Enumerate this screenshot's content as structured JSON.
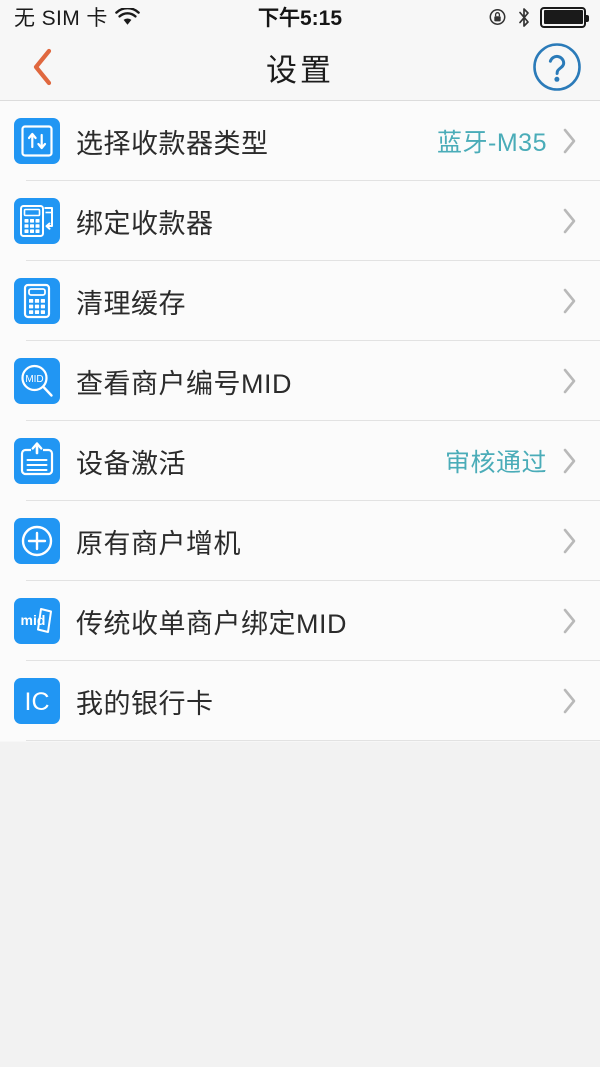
{
  "status_bar": {
    "carrier": "无 SIM 卡",
    "time": "下午5:15",
    "wifi_icon": "wifi-icon",
    "rotation_lock_icon": "rotation-lock-icon",
    "bluetooth_icon": "bluetooth-icon",
    "battery_icon": "battery-icon",
    "battery_level": 100
  },
  "nav": {
    "title": "设置",
    "back_icon": "chevron-left-icon",
    "help_icon": "question-circle-icon",
    "back_color": "#e0683f",
    "help_color": "#2b7bb9"
  },
  "theme": {
    "icon_blue": "#2196f3",
    "value_teal": "#4aacb8",
    "chevron_gray": "#b9b9b9",
    "background": "#f2f2f2",
    "row_background": "#fbfbfb"
  },
  "list": {
    "rows": [
      {
        "label": "选择收款器类型",
        "value": "蓝牙-M35",
        "icon": "updown-arrows-icon"
      },
      {
        "label": "绑定收款器",
        "value": "",
        "icon": "pos-terminal-icon"
      },
      {
        "label": "清理缓存",
        "value": "",
        "icon": "calculator-icon"
      },
      {
        "label": "查看商户编号MID",
        "value": "",
        "icon": "mid-magnifier-icon"
      },
      {
        "label": "设备激活",
        "value": "审核通过",
        "icon": "document-upload-icon"
      },
      {
        "label": "原有商户增机",
        "value": "",
        "icon": "plus-circle-icon"
      },
      {
        "label": "传统收单商户绑定MID",
        "value": "",
        "icon": "mid-card-icon"
      },
      {
        "label": "我的银行卡",
        "value": "",
        "icon": "ic-card-icon"
      }
    ]
  }
}
